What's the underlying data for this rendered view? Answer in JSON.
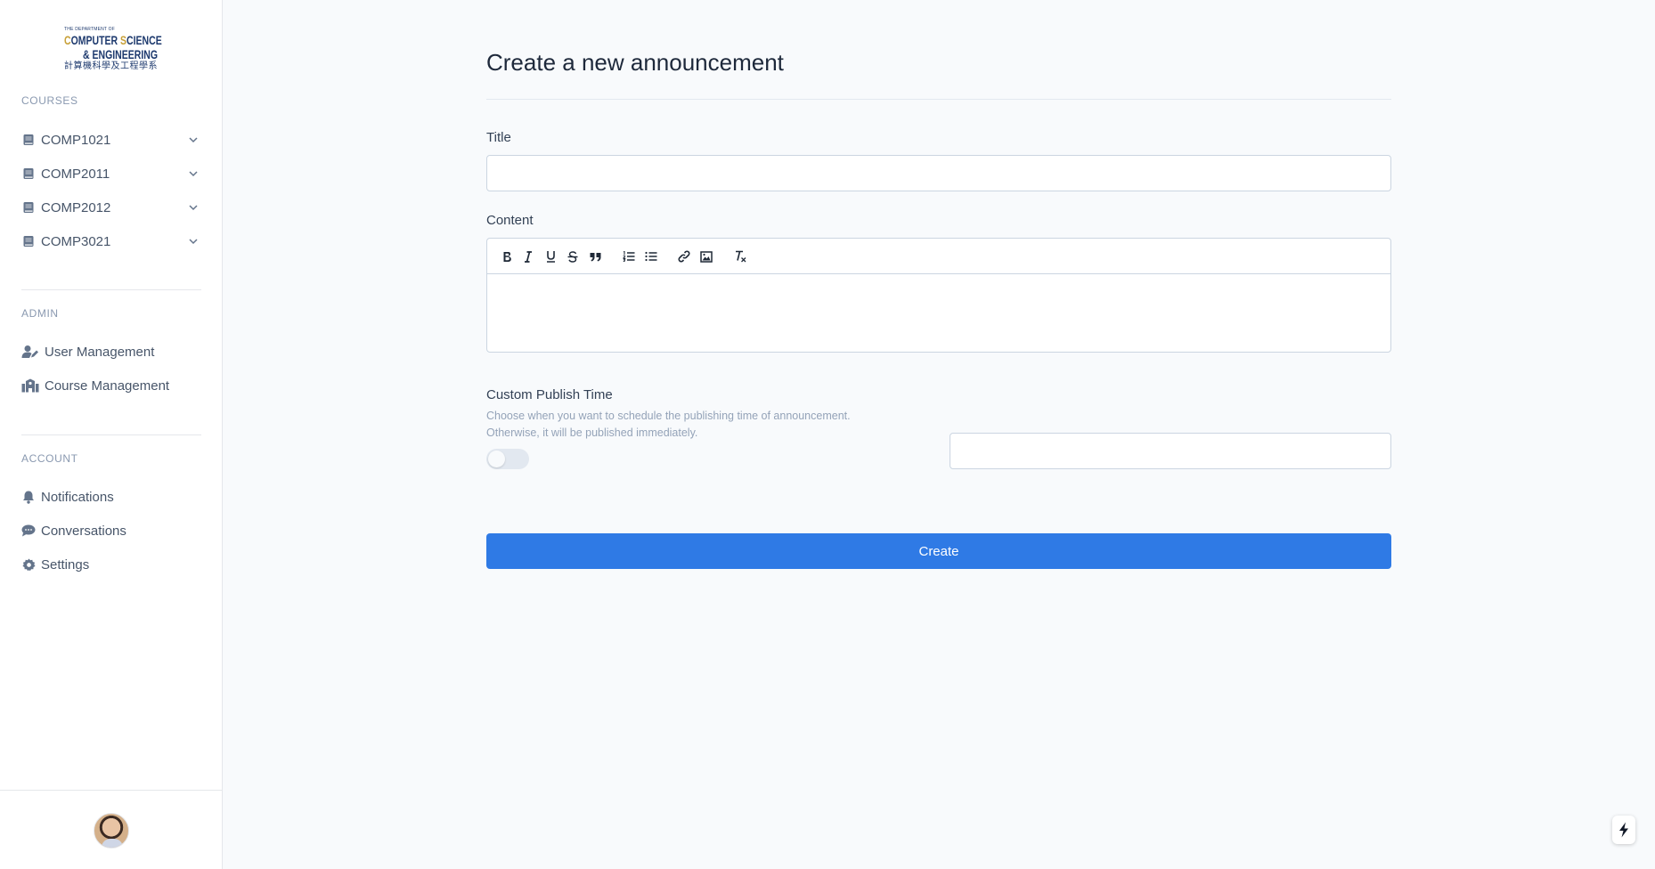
{
  "logo": {
    "line1": "THE DEPARTMENT OF",
    "line2_cap1": "C",
    "line2_rest1": "OMPUTER ",
    "line2_cap2": "S",
    "line2_rest2": "CIENCE",
    "line3": "& ENGINEERING",
    "line4": "計算機科學及工程學系"
  },
  "sidebar": {
    "courses_label": "COURSES",
    "courses": [
      {
        "label": "COMP1021"
      },
      {
        "label": "COMP2011"
      },
      {
        "label": "COMP2012"
      },
      {
        "label": "COMP3021"
      }
    ],
    "admin_label": "ADMIN",
    "admin_items": [
      {
        "label": "User Management",
        "icon": "user-edit-icon"
      },
      {
        "label": "Course Management",
        "icon": "school-icon"
      }
    ],
    "account_label": "ACCOUNT",
    "account_items": [
      {
        "label": "Notifications",
        "icon": "bell-icon"
      },
      {
        "label": "Conversations",
        "icon": "chat-icon"
      },
      {
        "label": "Settings",
        "icon": "gear-icon"
      }
    ]
  },
  "main": {
    "title": "Create a new announcement",
    "title_field_label": "Title",
    "title_value": "",
    "content_label": "Content",
    "toolbar": [
      "bold",
      "italic",
      "underline",
      "strike",
      "blockquote",
      "ordered-list",
      "bullet-list",
      "link",
      "image",
      "clear-format"
    ],
    "publish_label": "Custom Publish Time",
    "publish_desc_1": "Choose when you want to schedule the publishing time of announcement.",
    "publish_desc_2": "Otherwise, it will be published immediately.",
    "publish_toggle_on": false,
    "publish_time_value": "",
    "create_button": "Create"
  },
  "colors": {
    "accent": "#2f7ae5",
    "sidebar_text": "#475569",
    "section_label": "#8a99b0"
  }
}
